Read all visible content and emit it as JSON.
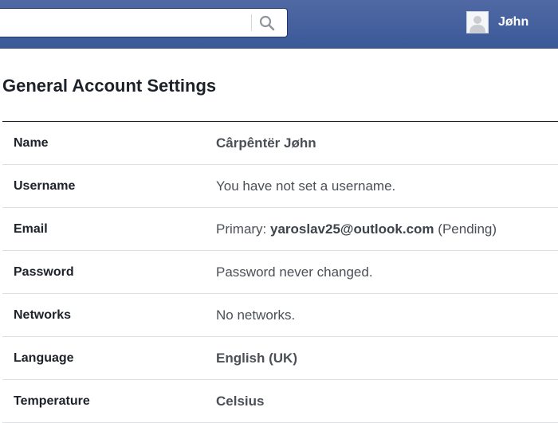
{
  "header": {
    "search": {
      "value": "",
      "placeholder": ""
    },
    "user": {
      "name": "Jøhn"
    }
  },
  "page": {
    "title": "General Account Settings"
  },
  "settings": {
    "name": {
      "label": "Name",
      "value": "Cârpêntër Jøhn"
    },
    "username": {
      "label": "Username",
      "value": "You have not set a username."
    },
    "email": {
      "label": "Email",
      "prefix": "Primary:",
      "address": "yaroslav25@outlook.com",
      "status": "(Pending)"
    },
    "password": {
      "label": "Password",
      "value": "Password never changed."
    },
    "networks": {
      "label": "Networks",
      "value": "No networks."
    },
    "language": {
      "label": "Language",
      "value": "English (UK)"
    },
    "temperature": {
      "label": "Temperature",
      "value": "Celsius"
    }
  },
  "colors": {
    "header_bg": "#3b5998",
    "text": "#1d2129",
    "value_text": "#4b4f56"
  }
}
